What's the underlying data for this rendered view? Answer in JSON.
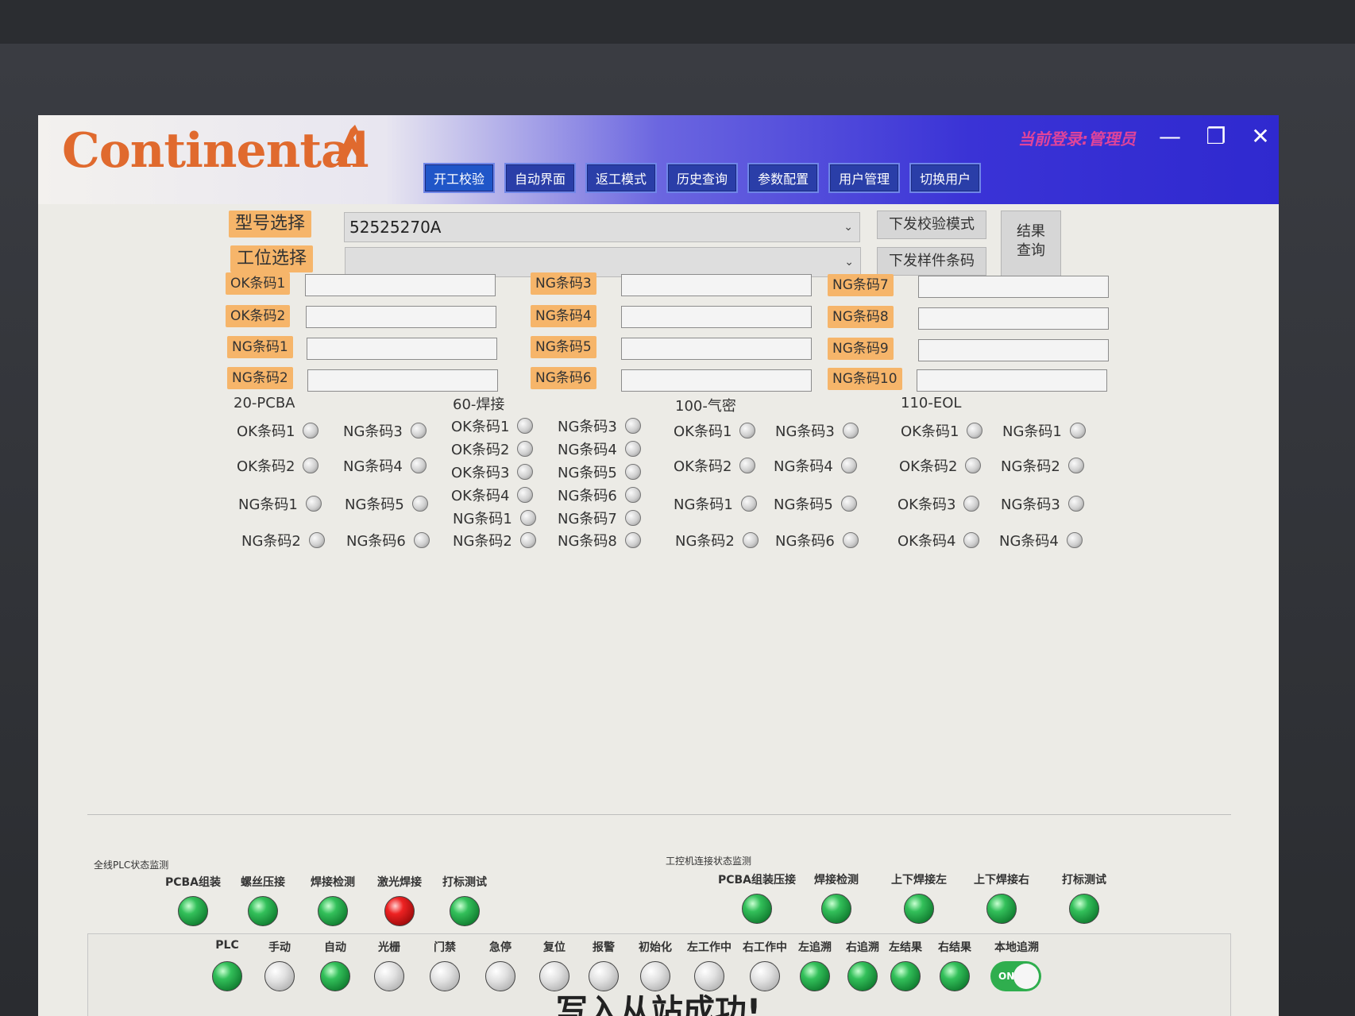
{
  "app": {
    "logo_text": "Continental",
    "login_user": "当前登录:管理员"
  },
  "nav": [
    "开工校验",
    "自动界面",
    "返工模式",
    "历史查询",
    "参数配置",
    "用户管理",
    "切换用户"
  ],
  "config": {
    "model_label": "型号选择",
    "model_value": "52525270A",
    "station_label": "工位选择",
    "station_value": "",
    "btn_send_mode": "下发校验模式",
    "btn_send_sample": "下发样件条码",
    "btn_result": "结果\n查询"
  },
  "barcodes": {
    "col1": [
      "OK条码1",
      "OK条码2",
      "NG条码1",
      "NG条码2"
    ],
    "col2": [
      "NG条码3",
      "NG条码4",
      "NG条码5",
      "NG条码6"
    ],
    "col3": [
      "NG条码7",
      "NG条码8",
      "NG条码9",
      "NG条码10"
    ]
  },
  "stations": {
    "s1": {
      "title": "20-PCBA",
      "left": [
        "OK条码1",
        "OK条码2",
        "NG条码1",
        "NG条码2"
      ],
      "right": [
        "NG条码3",
        "NG条码4",
        "NG条码5",
        "NG条码6"
      ]
    },
    "s2": {
      "title": "60-焊接",
      "left": [
        "OK条码1",
        "OK条码2",
        "OK条码3",
        "OK条码4",
        "NG条码1",
        "NG条码2"
      ],
      "right": [
        "NG条码3",
        "NG条码4",
        "NG条码5",
        "NG条码6",
        "NG条码7",
        "NG条码8"
      ]
    },
    "s3": {
      "title": "100-气密",
      "left": [
        "OK条码1",
        "OK条码2",
        "NG条码1",
        "NG条码2"
      ],
      "right": [
        "NG条码3",
        "NG条码4",
        "NG条码5",
        "NG条码6"
      ]
    },
    "s4": {
      "title": "110-EOL",
      "left": [
        "OK条码1",
        "OK条码2",
        "OK条码3",
        "OK条码4"
      ],
      "right": [
        "NG条码1",
        "NG条码2",
        "NG条码3",
        "NG条码4"
      ]
    }
  },
  "plc_monitor": {
    "title": "全线PLC状态监测",
    "items": [
      {
        "label": "PCBA组装",
        "state": "green"
      },
      {
        "label": "螺丝压接",
        "state": "green"
      },
      {
        "label": "焊接检测",
        "state": "green"
      },
      {
        "label": "激光焊接",
        "state": "red"
      },
      {
        "label": "打标测试",
        "state": "green"
      }
    ]
  },
  "ipc_monitor": {
    "title": "工控机连接状态监测",
    "items": [
      {
        "label": "PCBA组装压接",
        "state": "green"
      },
      {
        "label": "焊接检测",
        "state": "green"
      },
      {
        "label": "上下焊接左",
        "state": "green"
      },
      {
        "label": "上下焊接右",
        "state": "green"
      },
      {
        "label": "打标测试",
        "state": "green"
      }
    ]
  },
  "status_bar": {
    "items": [
      {
        "label": "PLC",
        "state": "green"
      },
      {
        "label": "手动",
        "state": "grey"
      },
      {
        "label": "自动",
        "state": "green"
      },
      {
        "label": "光栅",
        "state": "grey"
      },
      {
        "label": "门禁",
        "state": "grey"
      },
      {
        "label": "急停",
        "state": "grey"
      },
      {
        "label": "复位",
        "state": "grey"
      },
      {
        "label": "报警",
        "state": "grey"
      },
      {
        "label": "初始化",
        "state": "grey"
      },
      {
        "label": "左工作中",
        "state": "grey"
      },
      {
        "label": "右工作中",
        "state": "grey"
      },
      {
        "label": "左追溯",
        "state": "green"
      },
      {
        "label": "右追溯",
        "state": "green"
      },
      {
        "label": "左结果",
        "state": "green"
      },
      {
        "label": "右结果",
        "state": "green"
      }
    ],
    "toggle_label": "本地追溯",
    "toggle_state": "ON"
  },
  "message": "写入从站成功!"
}
